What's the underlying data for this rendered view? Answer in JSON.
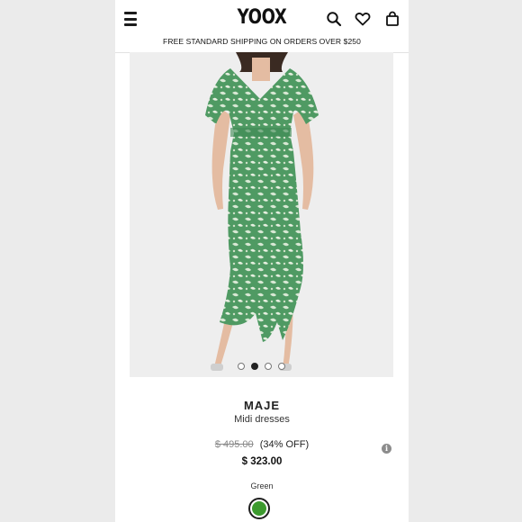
{
  "header": {
    "logo": "YOOX",
    "shipping_banner": "FREE STANDARD SHIPPING ON ORDERS OVER $250",
    "icons": [
      "menu-icon",
      "search-icon",
      "heart-icon",
      "bag-icon"
    ]
  },
  "gallery": {
    "image_subject": "model wearing green floral midi dress",
    "slide_count": 4,
    "active_slide": 2
  },
  "product": {
    "brand": "MAJE",
    "category": "Midi dresses",
    "original_price": "$ 495.00",
    "discount": "(34% OFF)",
    "price": "$ 323.00",
    "color_label": "Green",
    "color_hex": "#3c9a2e",
    "info_icon_glyph": "i"
  },
  "colors": {
    "dress_green": "#4f9a63",
    "background": "#eeeeee"
  }
}
